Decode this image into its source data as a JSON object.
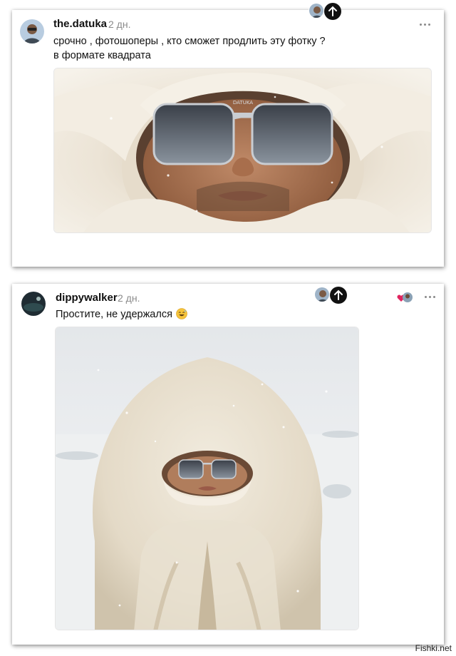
{
  "posts": [
    {
      "username": "the.datuka",
      "time": "2 дн.",
      "text_lines": [
        "срочно , фотошоперы , кто сможет продлить эту фотку ?",
        "в формате квадрата"
      ],
      "image": {
        "alt": "",
        "glasses_label": "DATUKA"
      }
    },
    {
      "username": "dippywalker",
      "time": "2 дн.",
      "text": "Простите, не удержался",
      "emoji": "sweat-smile",
      "image": {
        "alt": ""
      }
    }
  ],
  "icons": {
    "more": "more-horizontal-icon",
    "scroll_up": "arrow-up-icon",
    "like": "heart-icon"
  },
  "colors": {
    "card_bg": "#ffffff",
    "time": "#8a8a8a",
    "fab": "#111111",
    "like": "#e0245e"
  },
  "watermark": "Fishki.net"
}
